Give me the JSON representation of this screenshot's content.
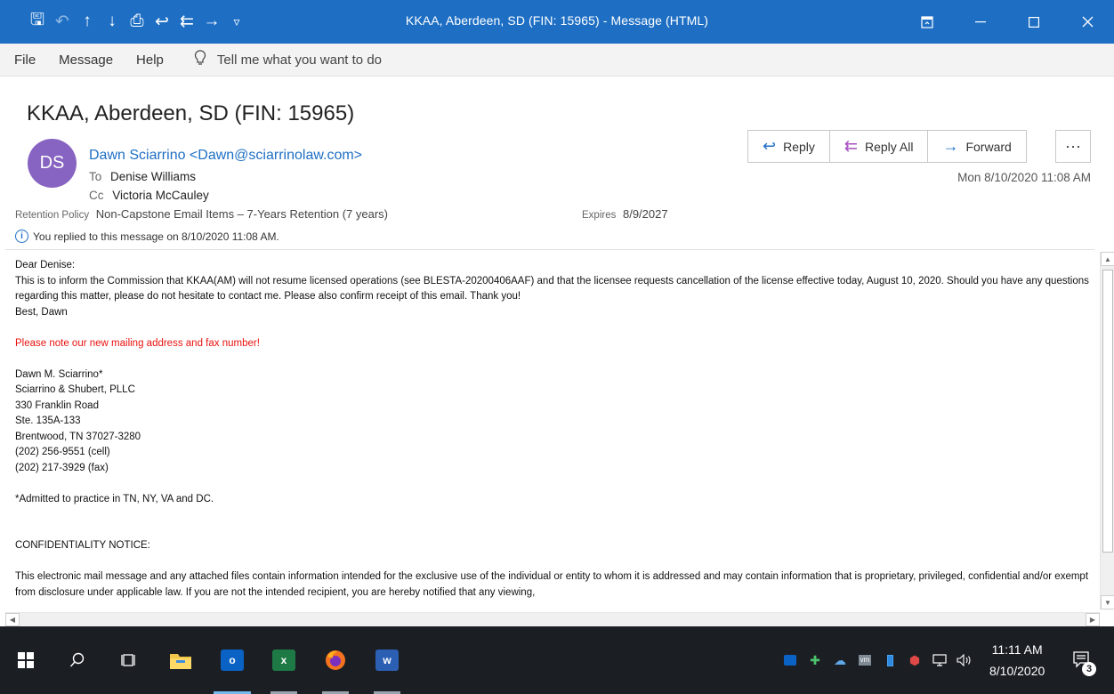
{
  "window": {
    "title": "KKAA, Aberdeen, SD (FIN: 15965)  -  Message (HTML)",
    "accent_color": "#1e6fc4"
  },
  "quick_access": [
    {
      "icon": "save-icon",
      "glyph": "🖫"
    },
    {
      "icon": "undo-icon",
      "glyph": "↶"
    },
    {
      "icon": "previous-item-icon",
      "glyph": "↑"
    },
    {
      "icon": "next-item-icon",
      "glyph": "↓"
    },
    {
      "icon": "print-icon",
      "glyph": "⎙"
    },
    {
      "icon": "reply-icon",
      "glyph": "↩"
    },
    {
      "icon": "reply-all-icon",
      "glyph": "⇇"
    },
    {
      "icon": "forward-icon",
      "glyph": "→"
    },
    {
      "icon": "customize-dropdown-icon",
      "glyph": "▿"
    }
  ],
  "menu": {
    "file": "File",
    "message": "Message",
    "help": "Help",
    "tell_me": "Tell me what you want to do"
  },
  "message": {
    "subject": "KKAA, Aberdeen, SD (FIN: 15965)",
    "avatar_initials": "DS",
    "avatar_color": "#8864c2",
    "sender": "Dawn Sciarrino <Dawn@sciarrinolaw.com>",
    "to_label": "To",
    "to": "Denise Williams",
    "cc_label": "Cc",
    "cc": "Victoria McCauley",
    "retention_label": "Retention Policy",
    "retention_value": "Non-Capstone Email Items – 7-Years Retention (7 years)",
    "expires_label": "Expires",
    "expires_value": "8/9/2027",
    "replied_note": "You replied to this message on 8/10/2020 11:08 AM.",
    "date": "Mon 8/10/2020 11:08 AM"
  },
  "actions": {
    "reply": "Reply",
    "reply_all": "Reply All",
    "forward": "Forward",
    "more": "···"
  },
  "body": {
    "greeting": "Dear Denise:",
    "paragraph": "This is to inform the Commission that KKAA(AM) will not resume licensed operations (see BLESTA-20200406AAF) and that the licensee requests cancellation of the license effective today, August 10, 2020.  Should you have any questions regarding this matter, please do not hesitate to contact me.  Please also confirm receipt of this email.  Thank you!",
    "closing": "Best, Dawn",
    "notice_red": "Please note our new mailing address and fax number!",
    "sig_name": "Dawn M. Sciarrino*",
    "sig_firm": "Sciarrino & Shubert, PLLC",
    "sig_addr1": "330 Franklin Road",
    "sig_addr2": "Ste. 135A-133",
    "sig_city": "Brentwood, TN 37027-3280",
    "sig_cell": "(202) 256-9551 (cell)",
    "sig_fax": "(202) 217-3929 (fax)",
    "admitted": "*Admitted to practice in TN, NY, VA and DC.",
    "conf_heading": "CONFIDENTIALITY NOTICE:",
    "conf_text": "This electronic mail message and any attached files contain information intended for the exclusive use of the individual or entity to whom it is  addressed and may contain information that is proprietary, privileged, confidential and/or exempt from disclosure under applicable law. If you are not the intended recipient, you are hereby notified that any viewing,"
  },
  "taskbar": {
    "time": "11:11 AM",
    "date": "8/10/2020",
    "notification_count": "3"
  }
}
